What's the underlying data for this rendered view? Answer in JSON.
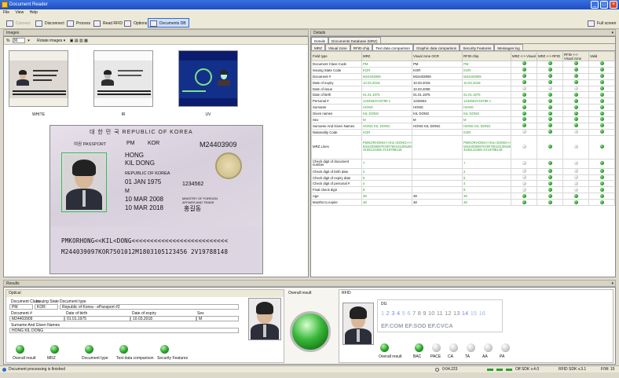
{
  "window": {
    "title": "Document Reader"
  },
  "menu": [
    "File",
    "View",
    "Help"
  ],
  "toolbar": {
    "connect": "Connect",
    "disconnect": "Disconnect",
    "process": "Process",
    "read_rfid": "Read RFID",
    "options": "Options",
    "documents_db": "Documents DB",
    "full_screen": "Full screen"
  },
  "images_panel": {
    "title": "Images",
    "zoom": "30",
    "rotate": "Rotate images",
    "thumbs": [
      "WHITE",
      "IR",
      "UV"
    ]
  },
  "passport": {
    "header": "대 한 민 국    REPUBLIC OF KOREA",
    "doc_label": "여권 PASSPORT",
    "type": "PM",
    "code": "KOR",
    "number": "M24403909",
    "surname": "HONG",
    "given": "KIL DONG",
    "nationality": "REPUBLIC OF KOREA",
    "dob": "01 JAN 1975",
    "personal_no": "1234562",
    "sex": "M",
    "issue": "10 MAR 2008",
    "authority": "MINISTRY OF FOREIGN AFFAIRS AND TRADE",
    "expiry": "10 MAR 2018",
    "signature": "홍길동",
    "mrz1": "PMKORHONG<<KIL<DONG<<<<<<<<<<<<<<<<<<<<<<<<<<",
    "mrz2": "M244039097KOR7501012M1803105123456 2V19788148"
  },
  "details_panel": {
    "title": "Details",
    "tabs": [
      "Details",
      "Documents Database (MRZ)"
    ],
    "subtabs": [
      "MRZ",
      "Visual zone",
      "RFID-chip",
      "Text data comparison",
      "Graphic data comparison",
      "Security Features",
      "Messages log"
    ],
    "columns": [
      "Field type",
      "MRZ",
      "Visual zone OCR",
      "RFID-chip",
      "MRZ <-> Visual",
      "MRZ <-> RFID",
      "RFID <-> Visual zone",
      "Valid"
    ],
    "rows": [
      {
        "f": "Document Class Code",
        "m": "PM",
        "v": "PM",
        "r": "PM",
        "d": [
          "g",
          "g",
          "g",
          "g"
        ]
      },
      {
        "f": "Issuing State Code",
        "m": "KOR",
        "v": "KOR",
        "r": "KOR",
        "d": [
          "g",
          "g",
          "g",
          "g"
        ]
      },
      {
        "f": "Document #",
        "m": "M24403909",
        "v": "M24403909",
        "r": "M24403909",
        "d": [
          "g",
          "g",
          "g",
          "g"
        ]
      },
      {
        "f": "Date of expiry",
        "m": "10.03.2018",
        "v": "10.03.2018",
        "r": "10.03.2018",
        "d": [
          "g",
          "g",
          "g",
          "g"
        ]
      },
      {
        "f": "Date of issue",
        "m": "",
        "v": "10.03.2008",
        "r": "",
        "d": [
          "x",
          "x",
          "x",
          "g"
        ]
      },
      {
        "f": "Date of birth",
        "m": "01.01.1975",
        "v": "01.01.1975",
        "r": "01.01.1975",
        "d": [
          "g",
          "g",
          "g",
          "g"
        ]
      },
      {
        "f": "Personal #",
        "m": "1234562V19788 1",
        "v": "1234562",
        "r": "1234562V19788 1",
        "d": [
          "g",
          "g",
          "g",
          "g"
        ]
      },
      {
        "f": "Surname",
        "m": "HONG",
        "v": "HONG",
        "r": "HONG",
        "d": [
          "g",
          "g",
          "g",
          "g"
        ]
      },
      {
        "f": "Given names",
        "m": "KIL DONG",
        "v": "KIL DONG",
        "r": "KIL DONG",
        "d": [
          "g",
          "g",
          "g",
          "g"
        ]
      },
      {
        "f": "Sex",
        "m": "M",
        "v": "M",
        "r": "M",
        "d": [
          "g",
          "g",
          "g",
          "g"
        ]
      },
      {
        "f": "Surname And Given Names",
        "m": "HONG KIL DONG",
        "v": "HONG KIL DONG",
        "r": "HONG KIL DONG",
        "d": [
          "g",
          "g",
          "g",
          "g"
        ]
      },
      {
        "f": "Nationality Code",
        "m": "KOR",
        "v": "",
        "r": "KOR",
        "d": [
          "x",
          "g",
          "x",
          "g"
        ]
      },
      {
        "f": "MRZ Lines",
        "m": "PMKORHONG<<KIL<DONG<<<<<<<<<<<<<<<<<<<<<<<<<<<<<<< M244039097KOR7501012M180 3105123456 2V19788148",
        "v": "",
        "r": "PMKORHONG<<KIL<DONG<<<<<<<<<<<<<<<<<<<<<<<<<<<<<<< M244039097KOR7501012M180 3105123456 2V19788148",
        "d": [
          "x",
          "g",
          "x",
          "g"
        ],
        "tall": true
      },
      {
        "f": "Check digit of document number",
        "m": "7",
        "v": "",
        "r": "7",
        "d": [
          "x",
          "g",
          "x",
          "g"
        ],
        "tall2": true
      },
      {
        "f": "Check digit of birth date",
        "m": "2",
        "v": "",
        "r": "2",
        "d": [
          "x",
          "g",
          "x",
          "g"
        ]
      },
      {
        "f": "Check digit of expiry date",
        "m": "5",
        "v": "",
        "r": "5",
        "d": [
          "x",
          "g",
          "x",
          "g"
        ]
      },
      {
        "f": "Check digit of personal #",
        "m": "4",
        "v": "",
        "r": "4",
        "d": [
          "x",
          "g",
          "x",
          "g"
        ]
      },
      {
        "f": "Final check digit",
        "m": "8",
        "v": "",
        "r": "8",
        "d": [
          "x",
          "g",
          "x",
          "g"
        ]
      },
      {
        "f": "Age",
        "m": "39",
        "v": "39",
        "r": "39",
        "d": [
          "g",
          "g",
          "g",
          "g"
        ]
      },
      {
        "f": "Months to expire",
        "m": "48",
        "v": "48",
        "r": "48",
        "d": [
          "g",
          "g",
          "g",
          "g"
        ]
      }
    ]
  },
  "results": {
    "title": "Results",
    "optical": {
      "title": "Optical",
      "doc_class_label": "Document Class",
      "issuing_state_label": "Issuing State",
      "doc_type_label": "Document type",
      "doc_class": "PM",
      "issuing_state": "KOR",
      "doc_type": "Republic of Korea - ePassport #2",
      "doc_no_label": "Document #",
      "dob_label": "Date of birth",
      "expiry_label": "Date of expiry",
      "sex_label": "Sex",
      "doc_no": "M24403909",
      "dob": "01.01.1975",
      "expiry": "10.03.2018",
      "sex": "M",
      "name_label": "Surname And Given Names",
      "name": "HONG KIL DONG",
      "indicators": [
        "Overall result",
        "MRZ",
        "Document type",
        "Text data comparison",
        "Security Features"
      ]
    },
    "overall": {
      "title": "Overall result"
    },
    "rfid": {
      "title": "RFID",
      "dg": "DG",
      "dg_nums": [
        "1",
        "2",
        "3",
        "4",
        "5",
        "6",
        "7",
        "8",
        "9",
        "10",
        "11",
        "12",
        "13",
        "14",
        "15",
        "16"
      ],
      "files": "EF.COM  EF.SOD  EF.CVCA",
      "indicators": [
        "Overall result",
        "BAC",
        "PACE",
        "CA",
        "TA",
        "AA",
        "PA"
      ]
    }
  },
  "status": {
    "message": "Document processing is finished",
    "time": "0:04.223",
    "sdk": "Off  SDK v.4.0",
    "rfid_sdk": "RFID SDK v.3.1",
    "fw": "F/W: 15"
  }
}
